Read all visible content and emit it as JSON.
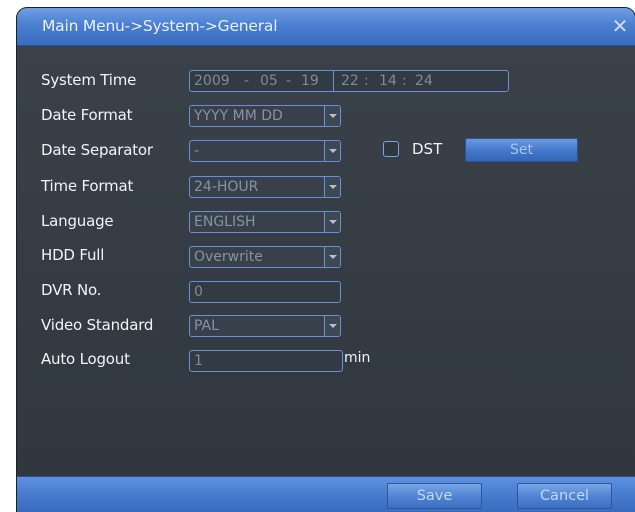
{
  "window": {
    "title": "Main Menu->System->General",
    "close_glyph": "✕"
  },
  "form": {
    "system_time": {
      "label": "System Time",
      "year": "2009",
      "month": "05",
      "day": "19",
      "hour": "22",
      "minute": "14",
      "second": "24",
      "date_sep": "-",
      "time_sep": ":"
    },
    "date_format": {
      "label": "Date Format",
      "value": "YYYY MM DD"
    },
    "date_separator": {
      "label": "Date Separator",
      "value": "-"
    },
    "time_format": {
      "label": "Time Format",
      "value": "24-HOUR"
    },
    "language": {
      "label": "Language",
      "value": "ENGLISH"
    },
    "hdd_full": {
      "label": "HDD Full",
      "value": "Overwrite"
    },
    "dvr_no": {
      "label": "DVR No.",
      "value": "0"
    },
    "video_standard": {
      "label": "Video Standard",
      "value": "PAL"
    },
    "auto_logout": {
      "label": "Auto Logout",
      "value": "1",
      "unit": "min"
    },
    "dst": {
      "label": "DST",
      "checked": false,
      "set_label": "Set"
    }
  },
  "footer": {
    "save_label": "Save",
    "cancel_label": "Cancel"
  },
  "colors": {
    "title_bar": "#4b7fd0",
    "panel_bg": "#353c44",
    "field_border": "#6a8fd6"
  }
}
